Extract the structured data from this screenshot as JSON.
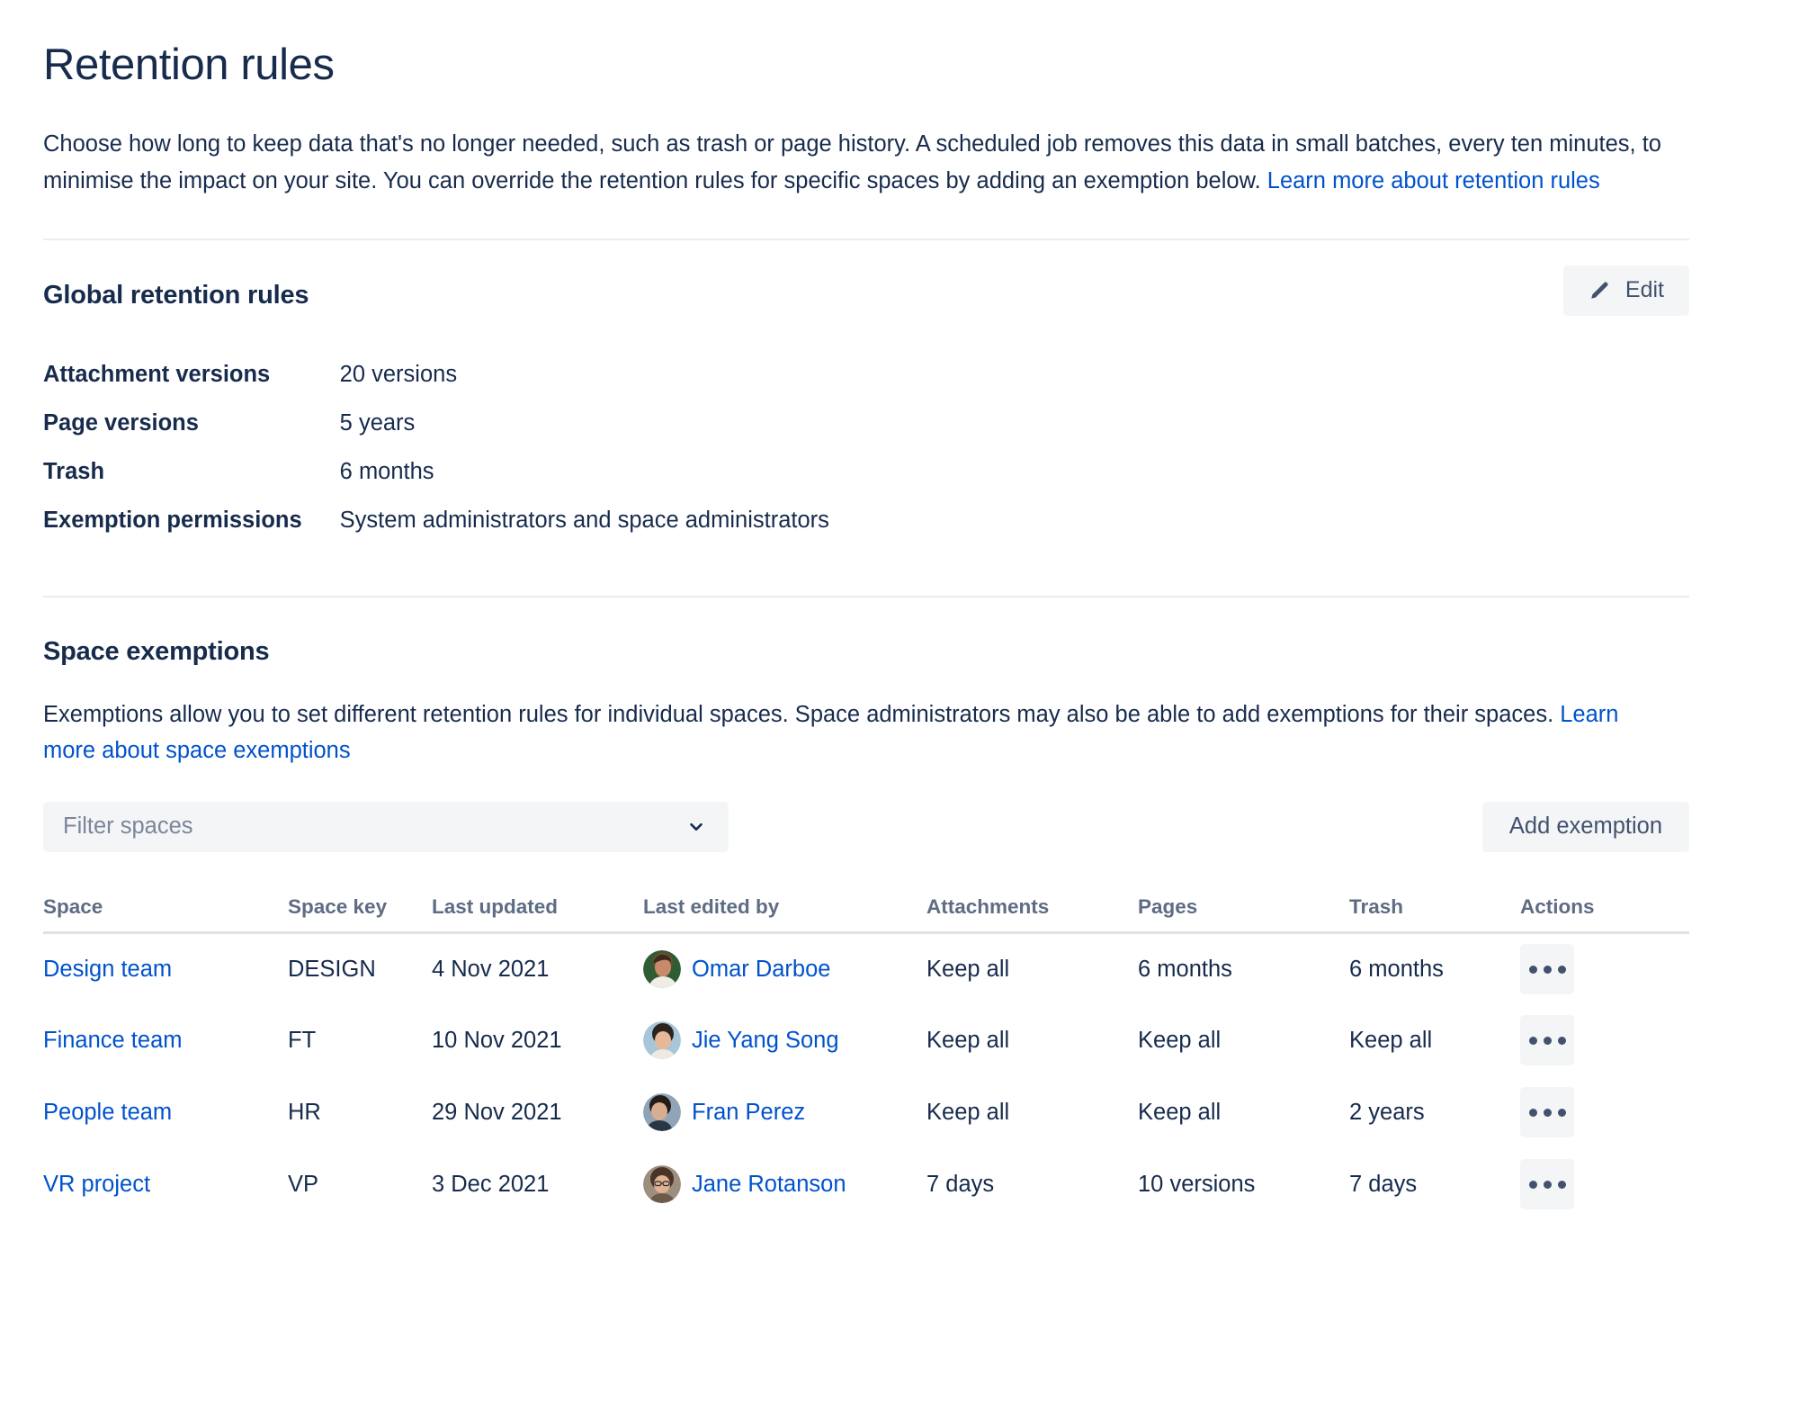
{
  "page": {
    "title": "Retention rules",
    "intro_before_link": "Choose how long to keep data that's no longer needed, such as trash or page history. A scheduled job removes this data in small batches, every ten minutes, to minimise the impact on your site. You can override the retention rules for specific spaces by adding an exemption below. ",
    "intro_link": "Learn more about retention rules"
  },
  "global_rules": {
    "heading": "Global retention rules",
    "edit_label": "Edit",
    "edit_icon": "pencil-icon",
    "rows": [
      {
        "label": "Attachment versions",
        "value": "20 versions"
      },
      {
        "label": "Page versions",
        "value": "5 years"
      },
      {
        "label": "Trash",
        "value": "6 months"
      },
      {
        "label": "Exemption permissions",
        "value": "System administrators and space administrators"
      }
    ]
  },
  "space_exemptions": {
    "heading": "Space exemptions",
    "desc_before_link": "Exemptions allow you to set different retention rules for individual spaces. Space administrators may also be able to add exemptions for their spaces. ",
    "desc_link": "Learn more about space exemptions",
    "filter": {
      "placeholder": "Filter spaces",
      "icon": "chevron-down-icon"
    },
    "add_button": "Add exemption",
    "table": {
      "columns": [
        "Space",
        "Space key",
        "Last updated",
        "Last edited by",
        "Attachments",
        "Pages",
        "Trash",
        "Actions"
      ],
      "rows": [
        {
          "space": "Design team",
          "space_key": "DESIGN",
          "last_updated": "4 Nov 2021",
          "editor": "Omar Darboe",
          "avatar_colors": [
            "#2F5D33",
            "#C98A6A",
            "#6E4B33"
          ],
          "attachments": "Keep all",
          "pages": "6 months",
          "trash": "6 months",
          "actions_icon": "more-actions-icon"
        },
        {
          "space": "Finance team",
          "space_key": "FT",
          "last_updated": "10 Nov 2021",
          "editor": "Jie Yang Song",
          "avatar_colors": [
            "#A8C6DA",
            "#E8B898",
            "#2B2520"
          ],
          "attachments": "Keep all",
          "pages": "Keep all",
          "trash": "Keep all",
          "actions_icon": "more-actions-icon"
        },
        {
          "space": "People team",
          "space_key": "HR",
          "last_updated": "29 Nov 2021",
          "editor": "Fran Perez",
          "avatar_colors": [
            "#90A4B8",
            "#D7AE91",
            "#241C17"
          ],
          "attachments": "Keep all",
          "pages": "Keep all",
          "trash": "2 years",
          "actions_icon": "more-actions-icon"
        },
        {
          "space": "VR project",
          "space_key": "VP",
          "last_updated": "3 Dec 2021",
          "editor": "Jane Rotanson",
          "avatar_colors": [
            "#9C8F7E",
            "#E0B293",
            "#4A3327"
          ],
          "attachments": "7 days",
          "pages": "10 versions",
          "trash": "7 days",
          "actions_icon": "more-actions-icon"
        }
      ]
    }
  },
  "colors": {
    "link": "#0052CC",
    "text": "#172B4D",
    "subtle_text": "#5E6C84",
    "placeholder": "#7A869A",
    "button_bg": "#F4F5F7",
    "divider": "#EBECF0",
    "table_rule": "#DFE1E6"
  }
}
